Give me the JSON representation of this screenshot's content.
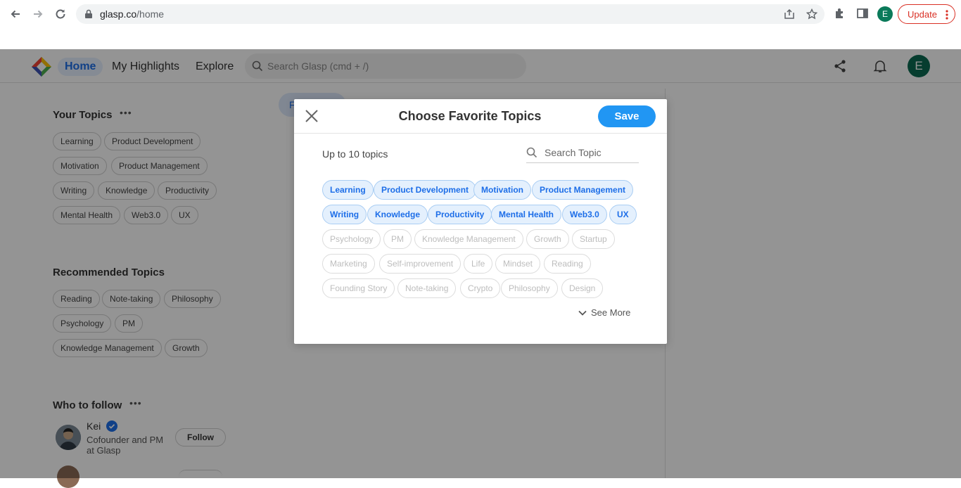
{
  "browser": {
    "url_host": "glasp.co",
    "url_path": "/home",
    "profile_initial": "E",
    "update_label": "Update"
  },
  "app": {
    "nav": {
      "home": "Home",
      "highlights": "My Highlights",
      "explore": "Explore"
    },
    "search_placeholder": "Search Glasp (cmd + /)",
    "avatar_initial": "E",
    "for_you_label": "For You",
    "your_topics": {
      "title": "Your Topics",
      "chips": [
        "Learning",
        "Product Development",
        "Motivation",
        "Product Management",
        "Writing",
        "Knowledge",
        "Productivity",
        "Mental Health",
        "Web3.0",
        "UX"
      ]
    },
    "recommended_topics": {
      "title": "Recommended Topics",
      "chips": [
        "Reading",
        "Note-taking",
        "Philosophy",
        "Psychology",
        "PM",
        "Knowledge Management",
        "Growth"
      ]
    },
    "who_to_follow": {
      "title": "Who to follow",
      "people": [
        {
          "name": "Kei",
          "description": "Cofounder and PM at Glasp",
          "button": "Follow"
        }
      ]
    }
  },
  "modal": {
    "title": "Choose Favorite Topics",
    "save_label": "Save",
    "limit_text": "Up to 10 topics",
    "search_placeholder": "Search Topic",
    "selected_topics": [
      "Learning",
      "Product Development",
      "Motivation",
      "Product Management",
      "Writing",
      "Knowledge",
      "Productivity",
      "Mental Health",
      "Web3.0",
      "UX"
    ],
    "other_topics": [
      "Psychology",
      "PM",
      "Knowledge Management",
      "Growth",
      "Startup",
      "Marketing",
      "Self-improvement",
      "Life",
      "Mindset",
      "Reading",
      "Founding Story",
      "Note-taking",
      "Crypto",
      "Philosophy",
      "Design"
    ],
    "see_more_label": "See More"
  },
  "colors": {
    "accent": "#2196f3",
    "selected_chip_bg": "#e4f0fd",
    "selected_chip_text": "#1d6ee8",
    "update_red": "#d93025"
  }
}
